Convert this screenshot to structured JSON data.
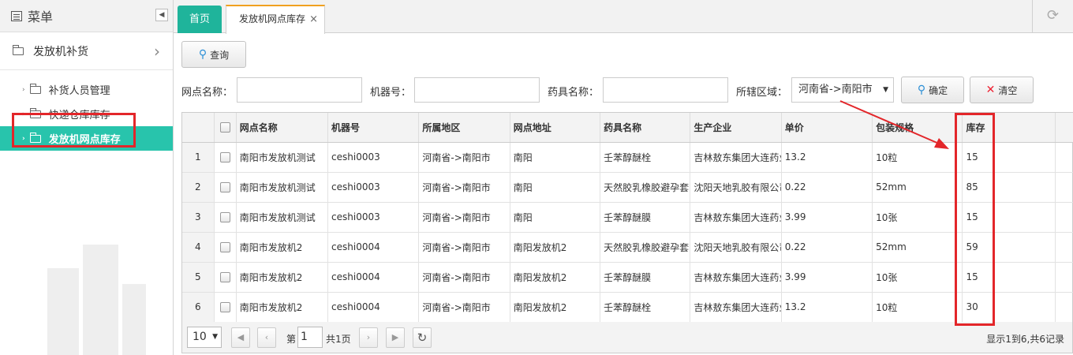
{
  "sidebar": {
    "title": "菜单",
    "group": "发放机补货",
    "items": [
      {
        "label": "补货人员管理"
      },
      {
        "label": "快递仓库库存"
      },
      {
        "label": "发放机网点库存"
      }
    ]
  },
  "tabs": {
    "home": "首页",
    "current": "发放机网点库存"
  },
  "toolbar": {
    "query": "查询"
  },
  "filters": {
    "outlet_label": "网点名称：",
    "machine_label": "机器号：",
    "drug_label": "药具名称：",
    "region_label": "所辖区域：",
    "region_value": "河南省->南阳市",
    "confirm": "确定",
    "clear": "清空"
  },
  "table": {
    "headers": [
      "网点名称",
      "机器号",
      "所属地区",
      "网点地址",
      "药具名称",
      "生产企业",
      "单价",
      "包装规格",
      "库存"
    ],
    "rows": [
      [
        "1",
        "南阳市发放机测试",
        "ceshi0003",
        "河南省->南阳市",
        "南阳",
        "壬苯醇醚栓",
        "吉林敖东集团大连药业",
        "13.2",
        "10粒",
        "15"
      ],
      [
        "2",
        "南阳市发放机测试",
        "ceshi0003",
        "河南省->南阳市",
        "南阳",
        "天然胶乳橡胶避孕套",
        "沈阳天地乳胶有限公司",
        "0.22",
        "52mm",
        "85"
      ],
      [
        "3",
        "南阳市发放机测试",
        "ceshi0003",
        "河南省->南阳市",
        "南阳",
        "壬苯醇醚膜",
        "吉林敖东集团大连药业",
        "3.99",
        "10张",
        "15"
      ],
      [
        "4",
        "南阳市发放机2",
        "ceshi0004",
        "河南省->南阳市",
        "南阳发放机2",
        "天然胶乳橡胶避孕套",
        "沈阳天地乳胶有限公司",
        "0.22",
        "52mm",
        "59"
      ],
      [
        "5",
        "南阳市发放机2",
        "ceshi0004",
        "河南省->南阳市",
        "南阳发放机2",
        "壬苯醇醚膜",
        "吉林敖东集团大连药业",
        "3.99",
        "10张",
        "15"
      ],
      [
        "6",
        "南阳市发放机2",
        "ceshi0004",
        "河南省->南阳市",
        "南阳发放机2",
        "壬苯醇醚栓",
        "吉林敖东集团大连药业",
        "13.2",
        "10粒",
        "30"
      ]
    ]
  },
  "pager": {
    "page_size": "10",
    "page_prefix": "第",
    "page_value": "1",
    "page_suffix": "共1页",
    "summary": "显示1到6,共6记录"
  },
  "colors": {
    "accent": "#28c4ac",
    "highlight": "#e3262a",
    "tab_border": "#f0a020"
  }
}
